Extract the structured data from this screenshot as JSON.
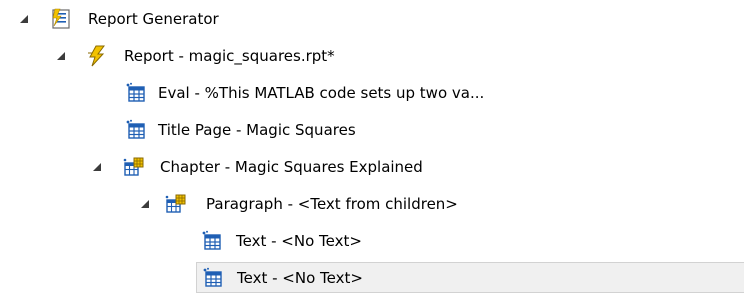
{
  "tree": {
    "nodes": [
      {
        "label": "Report Generator",
        "icon": "report-generator-icon",
        "expanded": true,
        "selected": false
      },
      {
        "label": "Report - magic_squares.rpt*",
        "icon": "report-lightning-icon",
        "expanded": true,
        "selected": false
      },
      {
        "label": "Eval - %This MATLAB code sets up two va...",
        "icon": "component-table-icon",
        "selected": false
      },
      {
        "label": "Title Page - Magic Squares",
        "icon": "component-table-icon",
        "selected": false
      },
      {
        "label": "Chapter - Magic Squares Explained",
        "icon": "component-container-icon",
        "expanded": true,
        "selected": false
      },
      {
        "label": "Paragraph - <Text from children>",
        "icon": "component-container-icon",
        "expanded": true,
        "selected": false
      },
      {
        "label": "Text - <No Text>",
        "icon": "component-table-icon",
        "selected": false
      },
      {
        "label": "Text - <No Text>",
        "icon": "component-table-icon",
        "selected": true
      }
    ]
  },
  "colors": {
    "selection_bg": "#f0f0f0",
    "selection_border": "#d2d2d2",
    "icon_blue": "#1f5fb4",
    "icon_yellow": "#f2c200",
    "toggle": "#3c3c3c"
  }
}
